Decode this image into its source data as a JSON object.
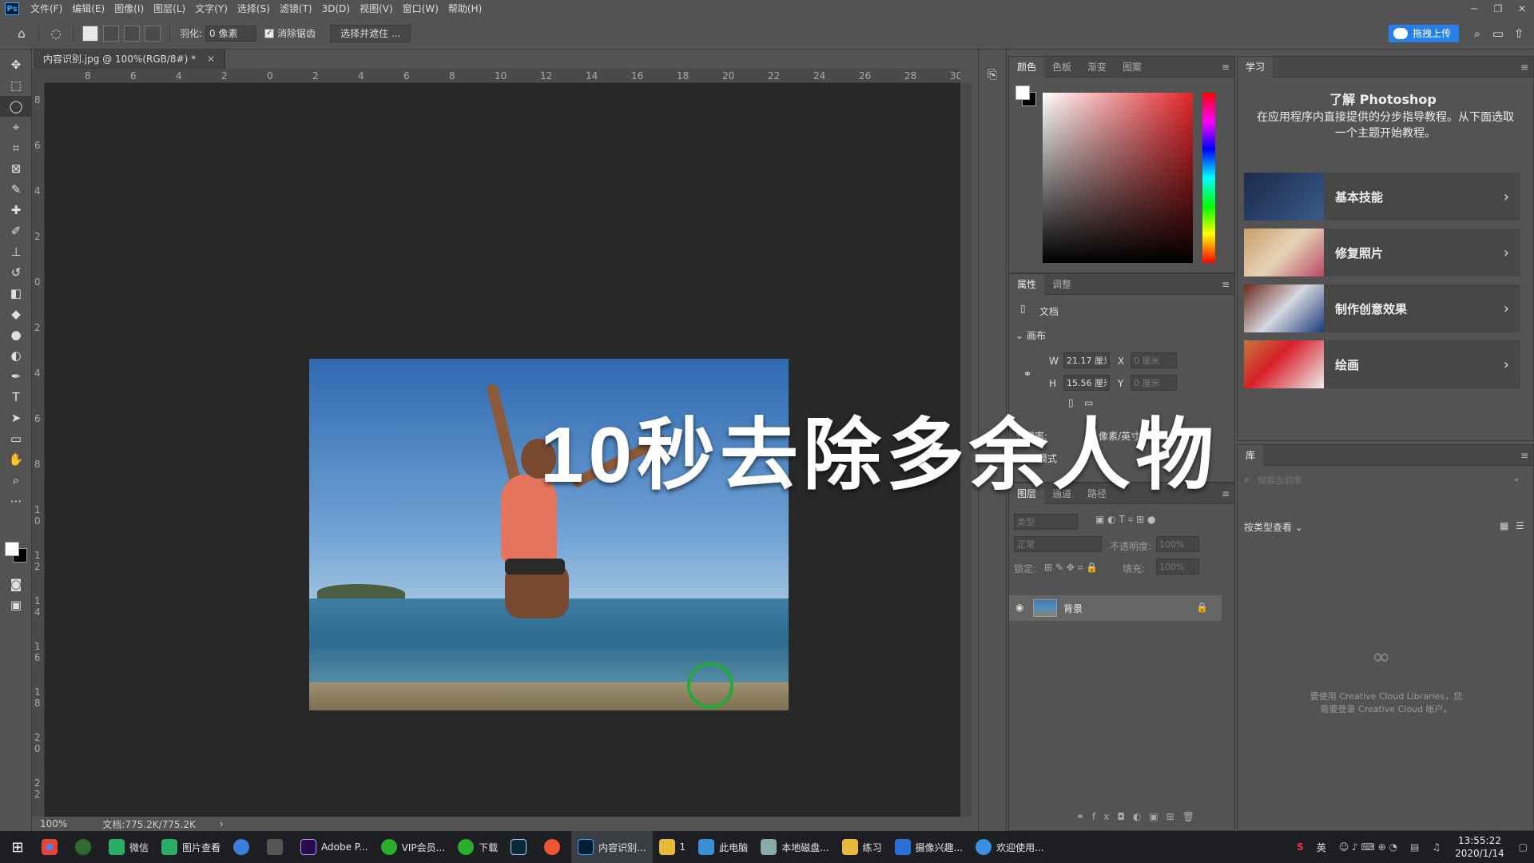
{
  "menu": {
    "logo": "Ps",
    "items": [
      "文件(F)",
      "编辑(E)",
      "图像(I)",
      "图层(L)",
      "文字(Y)",
      "选择(S)",
      "滤镜(T)",
      "3D(D)",
      "视图(V)",
      "窗口(W)",
      "帮助(H)"
    ]
  },
  "options": {
    "feather_label": "羽化:",
    "feather_value": "0 像素",
    "antialias_label": "消除锯齿",
    "select_mask_label": "选择并遮住 ...",
    "cloud_upload": "拖拽上传"
  },
  "document": {
    "tab_title": "内容识别.jpg @ 100%(RGB/8#) *",
    "ruler_h": [
      "8",
      "6",
      "4",
      "2",
      "0",
      "2",
      "4",
      "6",
      "8",
      "10",
      "12",
      "14",
      "16",
      "18",
      "20",
      "22",
      "24",
      "26",
      "28",
      "30"
    ],
    "ruler_v": [
      "8",
      "6",
      "4",
      "2",
      "0",
      "2",
      "4",
      "6",
      "8",
      "1 0",
      "1 2",
      "1 4",
      "1 6",
      "1 8",
      "2 0",
      "2 2"
    ],
    "zoom": "100%",
    "doc_size": "文档:775.2K/775.2K"
  },
  "overlay": {
    "title": "10秒去除多余人物"
  },
  "color_panel": {
    "tabs": [
      "颜色",
      "色板",
      "渐变",
      "图案"
    ]
  },
  "properties_panel": {
    "tabs": [
      "属性",
      "调整"
    ],
    "doc_label": "文档",
    "canvas_label": "画布",
    "w_label": "W",
    "w_value": "21.17 厘米",
    "h_label": "H",
    "h_value": "15.56 厘米",
    "x_label": "X",
    "x_value": "0 厘米",
    "y_label": "Y",
    "y_value": "0 厘米",
    "resolution_label": "分辨率:",
    "resolution_value": "像素/英寸",
    "mode_label": "模式"
  },
  "layers_panel": {
    "tabs": [
      "图层",
      "通道",
      "路径"
    ],
    "filter_placeholder": "类型",
    "blend_mode": "正常",
    "opacity_label": "不透明度:",
    "opacity_value": "100%",
    "lock_label": "锁定:",
    "fill_label": "填充:",
    "fill_value": "100%",
    "layer_name": "背景"
  },
  "learn_panel": {
    "tab": "学习",
    "title": "了解 Photoshop",
    "desc": "在应用程序内直接提供的分步指导教程。从下面选取一个主题开始教程。",
    "cards": [
      "基本技能",
      "修复照片",
      "制作创意效果",
      "绘画"
    ]
  },
  "library_panel": {
    "tab": "库",
    "search_placeholder": "搜索当前库",
    "view_label": "按类型查看",
    "cc_message_1": "要使用 Creative Cloud Libraries，您",
    "cc_message_2": "需要登录 Creative Cloud 帐户。"
  },
  "taskbar": {
    "items": [
      "微信",
      "图片查看",
      "Adobe P...",
      "VIP会员...",
      "下载",
      "内容识别...",
      "1",
      "此电脑",
      "本地磁盘...",
      "练习",
      "摄像兴趣...",
      "欢迎使用..."
    ],
    "ime": "英",
    "time": "13:55:22",
    "date": "2020/1/14"
  }
}
